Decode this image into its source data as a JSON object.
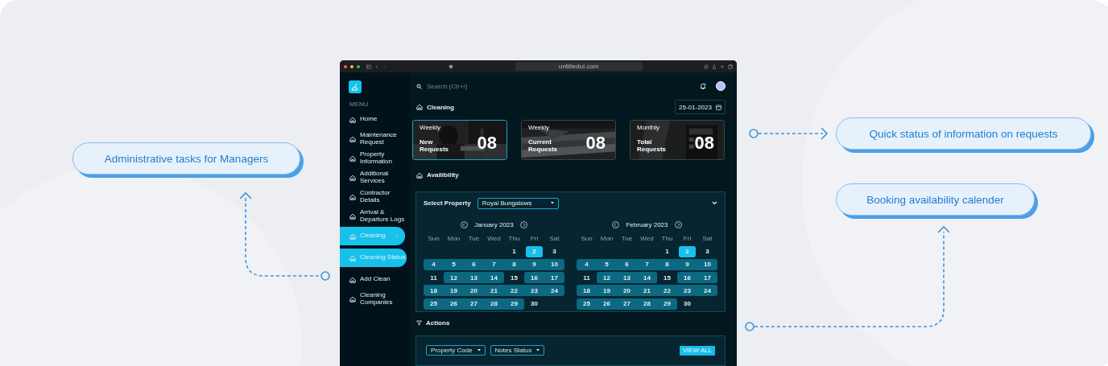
{
  "callouts": [
    {
      "text": "Administrative tasks for Managers"
    },
    {
      "text": "Quick status of information on requests"
    },
    {
      "text": "Booking availability calender"
    }
  ],
  "browser": {
    "url": "untitledui.com"
  },
  "sidebar": {
    "menu_label": "MENU",
    "items": [
      {
        "label": "Home",
        "selected": false
      },
      {
        "label": "Maintenance Request",
        "selected": false
      },
      {
        "label": "Property Information",
        "selected": false
      },
      {
        "label": "Additional Services",
        "selected": false
      },
      {
        "label": "Contractor Details",
        "selected": false
      },
      {
        "label": "Arrival & Departure Logs",
        "selected": false
      },
      {
        "label": "Cleaning",
        "selected": true,
        "expanded": true,
        "children": [
          {
            "label": "Cleaning Status",
            "selected": true
          },
          {
            "label": "Add Clean",
            "selected": false
          },
          {
            "label": "Cleaning Companies",
            "selected": false
          }
        ]
      }
    ]
  },
  "search": {
    "placeholder": "Search (Ctr+/)"
  },
  "header": {
    "title": "Cleaning",
    "date": "25-01-2023"
  },
  "stats": [
    {
      "period": "Weekly",
      "label": "New Requests",
      "value": "08",
      "selected": true
    },
    {
      "period": "Weekly",
      "label": "Current Requests",
      "value": "08",
      "selected": false
    },
    {
      "period": "Monthly",
      "label": "Total Requests",
      "value": "08",
      "selected": false
    }
  ],
  "availability": {
    "title": "Availibility",
    "property_label": "Select Property",
    "property": "Royal Bungalows",
    "months": [
      {
        "title": "January 2023",
        "weekdays": [
          "Sun",
          "Mon",
          "Tue",
          "Wed",
          "Thu",
          "Fri",
          "Sat"
        ],
        "weeks": [
          [
            {
              "day": "1",
              "booked": false,
              "selected": false
            },
            {
              "day": "2",
              "booked": false,
              "selected": true
            },
            {
              "day": "3",
              "booked": false,
              "selected": false
            }
          ],
          [
            {
              "day": "4",
              "booked": true,
              "selected": false
            },
            {
              "day": "5",
              "booked": true,
              "selected": false
            },
            {
              "day": "6",
              "booked": true,
              "selected": false
            },
            {
              "day": "7",
              "booked": true,
              "selected": false
            },
            {
              "day": "8",
              "booked": true,
              "selected": false
            },
            {
              "day": "9",
              "booked": true,
              "selected": false
            },
            {
              "day": "10",
              "booked": true,
              "selected": false
            }
          ],
          [
            {
              "day": "11",
              "booked": false,
              "selected": false
            },
            {
              "day": "12",
              "booked": true,
              "selected": false
            },
            {
              "day": "13",
              "booked": true,
              "selected": false
            },
            {
              "day": "14",
              "booked": true,
              "selected": false
            },
            {
              "day": "15",
              "booked": false,
              "selected": false
            },
            {
              "day": "16",
              "booked": true,
              "selected": false
            },
            {
              "day": "17",
              "booked": true,
              "selected": false
            }
          ],
          [
            {
              "day": "18",
              "booked": true,
              "selected": false
            },
            {
              "day": "19",
              "booked": true,
              "selected": false
            },
            {
              "day": "20",
              "booked": true,
              "selected": false
            },
            {
              "day": "21",
              "booked": true,
              "selected": false
            },
            {
              "day": "22",
              "booked": true,
              "selected": false
            },
            {
              "day": "23",
              "booked": true,
              "selected": false
            },
            {
              "day": "24",
              "booked": true,
              "selected": false
            }
          ],
          [
            {
              "day": "25",
              "booked": true,
              "selected": false
            },
            {
              "day": "26",
              "booked": true,
              "selected": false
            },
            {
              "day": "27",
              "booked": true,
              "selected": false
            },
            {
              "day": "28",
              "booked": true,
              "selected": false
            },
            {
              "day": "29",
              "booked": true,
              "selected": false
            },
            {
              "day": "30",
              "booked": false,
              "selected": false
            }
          ]
        ]
      },
      {
        "title": "February 2023",
        "weekdays": [
          "Sun",
          "Mon",
          "Tue",
          "Wed",
          "Thu",
          "Fri",
          "Sat"
        ],
        "weeks": [
          [
            {
              "day": "1",
              "booked": false,
              "selected": false
            },
            {
              "day": "2",
              "booked": false,
              "selected": true
            },
            {
              "day": "3",
              "booked": false,
              "selected": false
            }
          ],
          [
            {
              "day": "4",
              "booked": true,
              "selected": false
            },
            {
              "day": "5",
              "booked": true,
              "selected": false
            },
            {
              "day": "6",
              "booked": true,
              "selected": false
            },
            {
              "day": "7",
              "booked": true,
              "selected": false
            },
            {
              "day": "8",
              "booked": true,
              "selected": false
            },
            {
              "day": "9",
              "booked": true,
              "selected": false
            },
            {
              "day": "10",
              "booked": true,
              "selected": false
            }
          ],
          [
            {
              "day": "11",
              "booked": false,
              "selected": false
            },
            {
              "day": "12",
              "booked": true,
              "selected": false
            },
            {
              "day": "13",
              "booked": true,
              "selected": false
            },
            {
              "day": "14",
              "booked": true,
              "selected": false
            },
            {
              "day": "15",
              "booked": false,
              "selected": false
            },
            {
              "day": "16",
              "booked": true,
              "selected": false
            },
            {
              "day": "17",
              "booked": true,
              "selected": false
            }
          ],
          [
            {
              "day": "18",
              "booked": true,
              "selected": false
            },
            {
              "day": "19",
              "booked": true,
              "selected": false
            },
            {
              "day": "20",
              "booked": true,
              "selected": false
            },
            {
              "day": "21",
              "booked": true,
              "selected": false
            },
            {
              "day": "22",
              "booked": true,
              "selected": false
            },
            {
              "day": "23",
              "booked": true,
              "selected": false
            },
            {
              "day": "24",
              "booked": true,
              "selected": false
            }
          ],
          [
            {
              "day": "25",
              "booked": true,
              "selected": false
            },
            {
              "day": "26",
              "booked": true,
              "selected": false
            },
            {
              "day": "27",
              "booked": true,
              "selected": false
            },
            {
              "day": "28",
              "booked": true,
              "selected": false
            },
            {
              "day": "29",
              "booked": true,
              "selected": false
            },
            {
              "day": "30",
              "booked": false,
              "selected": false
            }
          ]
        ]
      }
    ]
  },
  "actions": {
    "title": "Actions",
    "filters": [
      "Property Code",
      "Notes Status"
    ],
    "button": "VIEW ALL"
  }
}
